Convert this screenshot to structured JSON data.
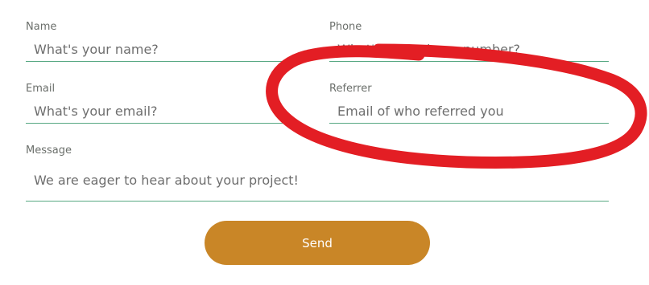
{
  "form": {
    "name": {
      "label": "Name",
      "placeholder": "What's your name?"
    },
    "phone": {
      "label": "Phone",
      "placeholder": "What's your phone number?"
    },
    "email": {
      "label": "Email",
      "placeholder": "What's your email?"
    },
    "referrer": {
      "label": "Referrer",
      "placeholder": "Email of who referred you"
    },
    "message": {
      "label": "Message",
      "placeholder": "We are eager to hear about your project!"
    },
    "send_label": "Send"
  },
  "colors": {
    "accent_underline": "#56a882",
    "button_background": "#c98627",
    "annotation_red": "#e31e24",
    "label_text": "#6b6f6b"
  }
}
